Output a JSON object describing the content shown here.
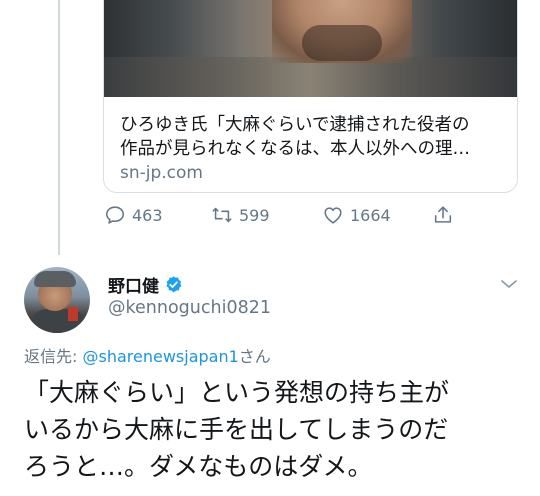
{
  "link_card": {
    "title_line1": "ひろゆき氏「大麻ぐらいで逮捕された役者の",
    "title_line2": "作品が見られなくなるは、本人以外への理…",
    "domain": "sn-jp.com"
  },
  "actions": {
    "reply_count": "463",
    "retweet_count": "599",
    "like_count": "1664",
    "icons": [
      "reply-icon",
      "retweet-icon",
      "like-icon",
      "share-icon"
    ]
  },
  "reply": {
    "display_name": "野口健",
    "handle": "@kennoguchi0821",
    "reply_to_prefix": "返信先: ",
    "reply_to_mention": "@sharenewsjapan1",
    "reply_to_suffix": "さん",
    "text_lines": [
      "「大麻ぐらい」という発想の持ち主が",
      "いるから大麻に手を出してしまうのだ",
      "ろうと…。ダメなものはダメ。"
    ]
  },
  "colors": {
    "text": "#14171a",
    "secondary": "#657786",
    "link": "#1b95e0",
    "verified": "#1da1f2",
    "border": "#d8dfe4"
  }
}
